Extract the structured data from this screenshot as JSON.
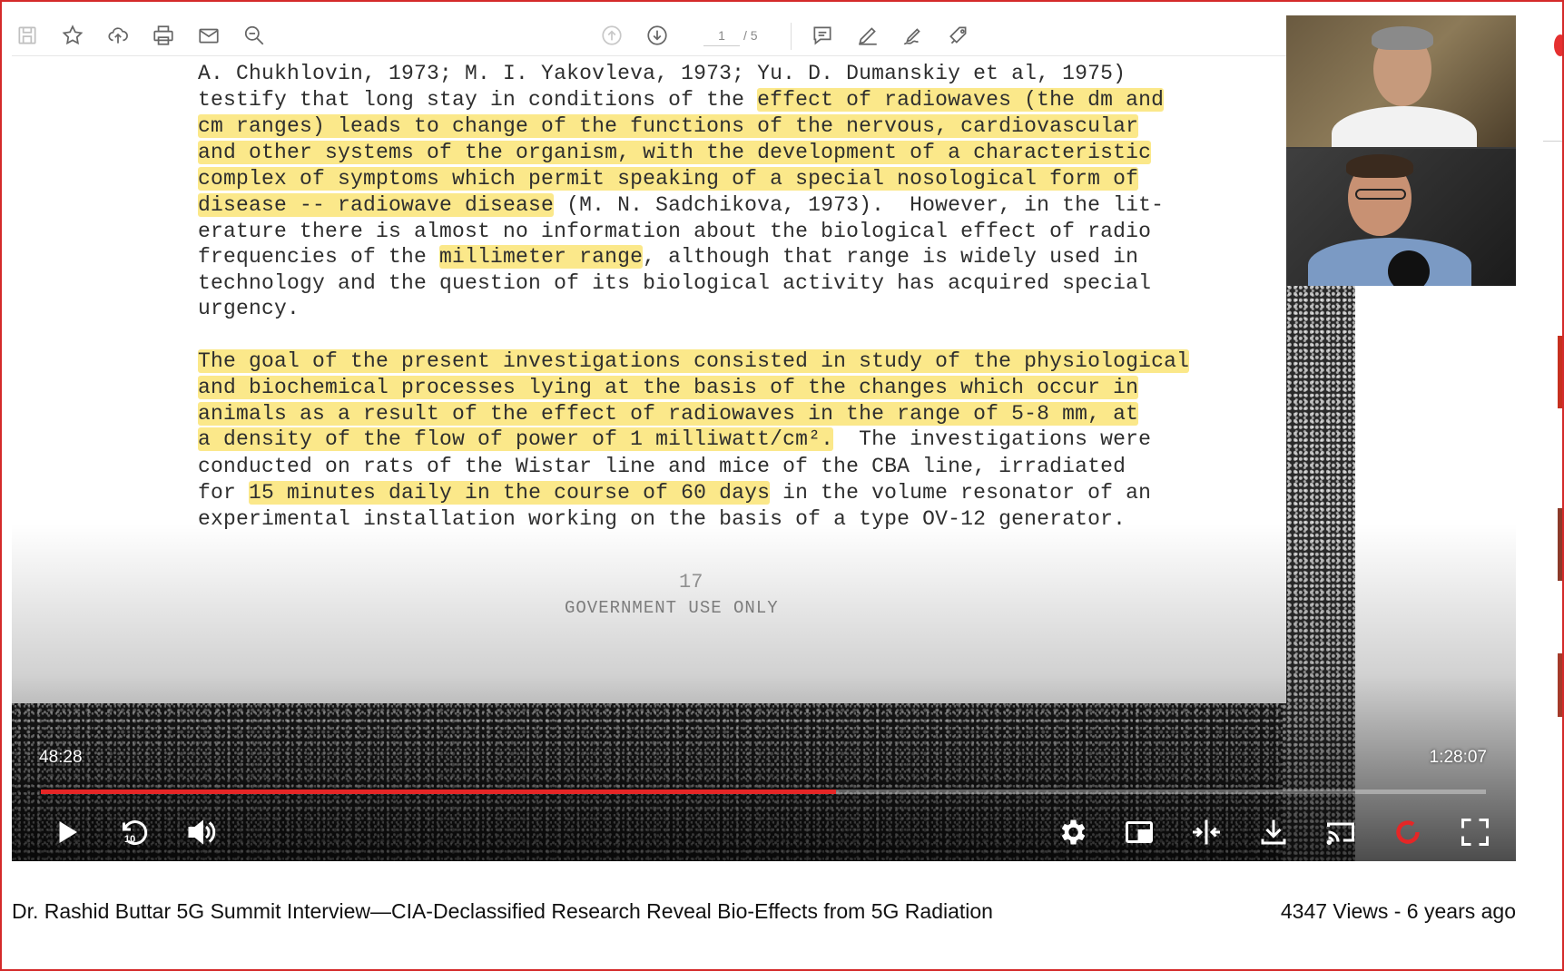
{
  "pdf_toolbar": {
    "page_current": "1",
    "page_total": "/ 5",
    "icons_left": [
      "save-icon",
      "star-icon",
      "upload-icon",
      "print-icon",
      "mail-icon",
      "zoom-out-icon"
    ],
    "icons_center": [
      "prev-page-icon",
      "next-page-icon"
    ],
    "icons_right": [
      "comment-icon",
      "pen-icon",
      "signature-icon",
      "stamp-icon"
    ]
  },
  "document": {
    "lines": [
      {
        "segments": [
          {
            "t": "A. Chukhlovin, 1973; M. I. Yakovleva, 1973; Yu. D. Dumanskiy et al, 1975)",
            "h": false
          }
        ]
      },
      {
        "segments": [
          {
            "t": "testify that long stay in conditions of the ",
            "h": false
          },
          {
            "t": "effect of radiowaves (the dm and",
            "h": true
          }
        ]
      },
      {
        "segments": [
          {
            "t": "cm ranges) leads to change of the functions of the nervous, cardiovascular",
            "h": true
          }
        ]
      },
      {
        "segments": [
          {
            "t": "and other systems of the organism, with the development of a characteristic",
            "h": true
          }
        ]
      },
      {
        "segments": [
          {
            "t": "complex of symptoms which permit speaking of a special nosological form of",
            "h": true
          }
        ]
      },
      {
        "segments": [
          {
            "t": "disease -- radiowave disease",
            "h": true
          },
          {
            "t": " (M. N. Sadchikova, 1973).  However, in the lit-",
            "h": false
          }
        ]
      },
      {
        "segments": [
          {
            "t": "erature there is almost no information about the biological effect of radio",
            "h": false
          }
        ]
      },
      {
        "segments": [
          {
            "t": "frequencies of the ",
            "h": false
          },
          {
            "t": "millimeter range",
            "h": true
          },
          {
            "t": ", although that range is widely used in",
            "h": false
          }
        ]
      },
      {
        "segments": [
          {
            "t": "technology and the question of its biological activity has acquired special",
            "h": false
          }
        ]
      },
      {
        "segments": [
          {
            "t": "urgency.",
            "h": false
          }
        ]
      },
      {
        "segments": [
          {
            "t": "The goal of the present investigations consisted in study of the physiological",
            "h": true
          }
        ]
      },
      {
        "segments": [
          {
            "t": "and biochemical processes lying at the basis of the changes which occur in",
            "h": true
          }
        ]
      },
      {
        "segments": [
          {
            "t": "animals as a result of the effect of radiowaves in the range of 5-8 mm, at",
            "h": true
          }
        ]
      },
      {
        "segments": [
          {
            "t": "a density of the flow of power of 1 milliwatt/cm².",
            "h": true
          },
          {
            "t": "  The investigations were",
            "h": false
          }
        ]
      },
      {
        "segments": [
          {
            "t": "conducted on rats of the Wistar line and mice of the CBA line, irradiated",
            "h": false
          }
        ]
      },
      {
        "segments": [
          {
            "t": "for ",
            "h": false
          },
          {
            "t": "15 minutes daily in the course of 60 days",
            "h": true
          },
          {
            "t": " in the volume resonator of an",
            "h": false
          }
        ]
      },
      {
        "segments": [
          {
            "t": "experimental installation working on the basis of a type OV-12 generator.",
            "h": false
          }
        ]
      }
    ],
    "page_number": "17",
    "footer": "GOVERNMENT USE ONLY",
    "highlight_color": "#fbe88a"
  },
  "player": {
    "time_current": "48:28",
    "time_total": "1:28:07",
    "progress": 0.55,
    "progress_color": "#e52626"
  },
  "video": {
    "title": "Dr. Rashid Buttar 5G Summit Interview—CIA-Declassified Research Reveal Bio-Effects from 5G Radiation",
    "meta": "4347 Views - 6 years ago"
  }
}
